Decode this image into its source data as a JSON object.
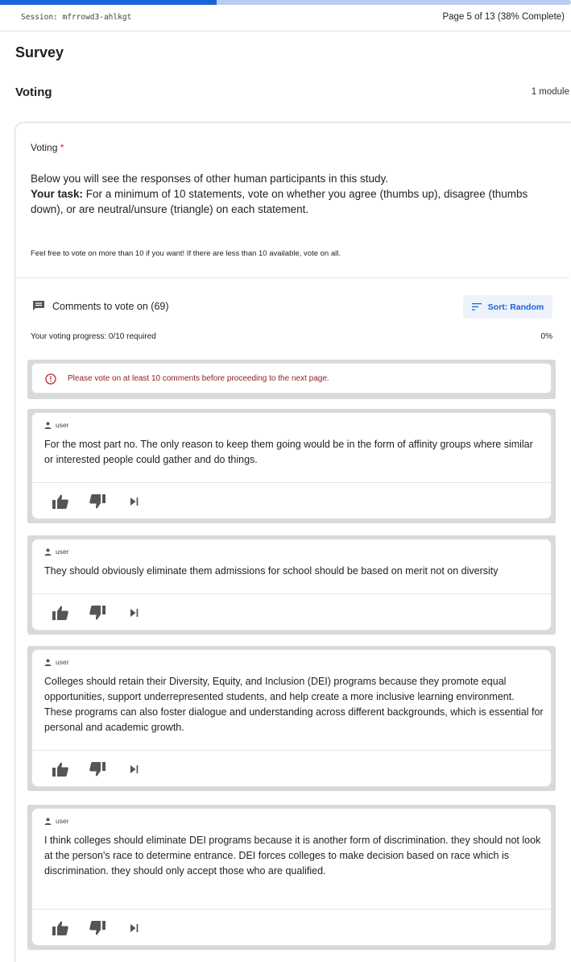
{
  "header": {
    "session": "Session: mfrrowd3-ahlkgt",
    "page_progress": "Page 5 of 13 (38% Complete)",
    "progress_fraction": 0.38
  },
  "page": {
    "title": "Survey",
    "section_title": "Voting",
    "module_count": "1 module"
  },
  "question": {
    "label": "Voting",
    "required_marker": "*",
    "instruction_1": "Below you will see the responses of other human participants in this study.",
    "instruction_2_bold": "Your task:",
    "instruction_2": " For a minimum of 10 statements, vote on whether you agree (thumbs up), disagree (thumbs down), or are neutral/unsure (triangle) on each statement.",
    "instruction_3": "Feel free to vote on more than 10 if you want! If there are less than 10 available, vote on all."
  },
  "comments_panel": {
    "heading": "Comments to vote on (69)",
    "sort_label": "Sort: Random",
    "progress_label": "Your voting progress: 0/10 required",
    "progress_percent": "0%",
    "warning": "Please vote on at least 10 comments before proceeding to the next page."
  },
  "comments": [
    {
      "author": "user",
      "text": "For the most part no. The only reason to keep them going would be in the form of affinity groups where similar or interested people could gather and do things."
    },
    {
      "author": "user",
      "text": "They should obviously eliminate them admissions for school should be based on merit not on diversity"
    },
    {
      "author": "user",
      "text": "Colleges should retain their Diversity, Equity, and Inclusion (DEI) programs because they promote equal opportunities, support underrepresented students, and help create a more inclusive learning environment. These programs can also foster dialogue and understanding across different backgrounds, which is essential for personal and academic growth."
    },
    {
      "author": "user",
      "text": "I think colleges should eliminate DEI programs because it is another form of discrimination. they should not look at the person's race to determine entrance. DEI forces colleges to make decision based on race which is discrimination. they should only accept those who are qualified."
    }
  ],
  "icons": {
    "comments": "comment-icon",
    "sort": "sort-icon",
    "warning": "error-circle-icon",
    "user": "person-icon",
    "agree": "thumbs-up-icon",
    "disagree": "thumbs-down-icon",
    "neutral": "skip-triangle-icon"
  },
  "colors": {
    "accent": "#1a63d8",
    "progress_track": "#b9cdf3",
    "required": "#c62828",
    "warning_text": "#8c1d1d",
    "icon": "#555555"
  }
}
